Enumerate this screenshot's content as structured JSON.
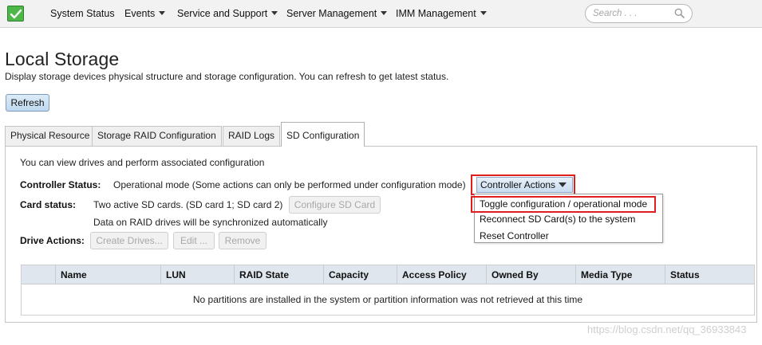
{
  "nav": {
    "items": [
      {
        "label": "System Status",
        "dropdown": false
      },
      {
        "label": "Events",
        "dropdown": true
      },
      {
        "label": "Service and Support",
        "dropdown": true
      },
      {
        "label": "Server Management",
        "dropdown": true
      },
      {
        "label": "IMM Management",
        "dropdown": true
      }
    ],
    "search_placeholder": "Search . . ."
  },
  "page": {
    "title": "Local Storage",
    "description": "Display storage devices physical structure and storage configuration. You can refresh to get latest status.",
    "refresh_label": "Refresh"
  },
  "tabs": [
    {
      "label": "Physical Resource",
      "active": false
    },
    {
      "label": "Storage RAID Configuration",
      "active": false
    },
    {
      "label": "RAID Logs",
      "active": false
    },
    {
      "label": "SD Configuration",
      "active": true
    }
  ],
  "sd": {
    "intro": "You can view drives and perform associated configuration",
    "controller_status_label": "Controller Status:",
    "controller_status_value": "Operational mode (Some actions can only be performed under configuration mode)",
    "controller_actions_label": "Controller Actions",
    "card_status_label": "Card status:",
    "card_status_value": "Two active SD cards. (SD card 1; SD card 2)",
    "configure_sd_label": "Configure SD Card",
    "sync_note": "Data on RAID drives will be synchronized automatically",
    "drive_actions_label": "Drive Actions:",
    "create_drives_label": "Create Drives...",
    "edit_label": "Edit ...",
    "remove_label": "Remove"
  },
  "menu": {
    "items": [
      "Toggle configuration / operational mode",
      "Reconnect SD Card(s) to the system",
      "Reset Controller"
    ]
  },
  "table": {
    "columns": [
      "",
      "Name",
      "LUN",
      "RAID State",
      "Capacity",
      "Access Policy",
      "Owned By",
      "Media Type",
      "Status"
    ],
    "empty_message": "No partitions are installed in the system or partition information was not retrieved at this time"
  },
  "watermark": "https://blog.csdn.net/qq_36933843",
  "colors": {
    "highlight_border": "#e01e1e",
    "primary_button": "#c9dcef",
    "logo_green": "#4db849"
  }
}
